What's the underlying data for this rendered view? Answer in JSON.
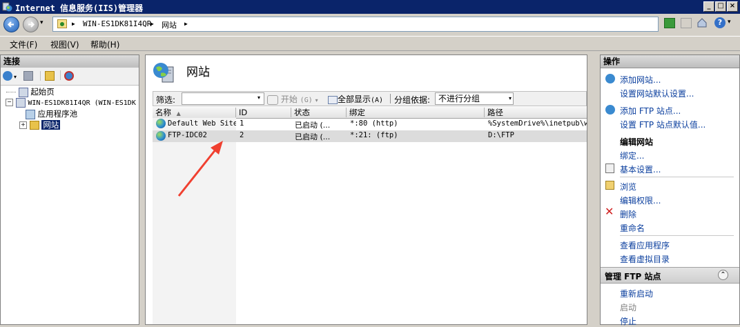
{
  "window": {
    "title": "Internet 信息服务(IIS)管理器",
    "controls": {
      "minimize": "_",
      "maximize": "□",
      "close": "×"
    }
  },
  "address": {
    "arrow": "▶",
    "segments": [
      "WIN-ES1DK81I4QR",
      "网站"
    ]
  },
  "menu": {
    "items": [
      "文件(F)",
      "视图(V)",
      "帮助(H)"
    ]
  },
  "connections": {
    "header": "连接",
    "tree": [
      {
        "label": "起始页"
      },
      {
        "label": "WIN-ES1DK81I4QR (WIN-ES1DK"
      },
      {
        "label": "应用程序池"
      },
      {
        "label": "网站"
      }
    ]
  },
  "center": {
    "title": "网站",
    "filter": {
      "label": "筛选:",
      "start_label": "开始",
      "start_shortcut": "(G)",
      "show_all": "全部显示",
      "show_all_shortcut": "(A)",
      "group_by_label": "分组依据:",
      "group_by_value": "不进行分组"
    },
    "columns": [
      "名称",
      "ID",
      "状态",
      "绑定",
      "路径"
    ],
    "rows": [
      {
        "name": "Default Web Site",
        "id": "1",
        "status": "已启动 (...",
        "binding": "*:80 (http)",
        "path": "%SystemDrive%\\inetpub\\ww"
      },
      {
        "name": "FTP-IDC02",
        "id": "2",
        "status": "已启动 (...",
        "binding": "*:21: (ftp)",
        "path": "D:\\FTP"
      }
    ]
  },
  "actions": {
    "header": "操作",
    "group1": [
      "添加网站...",
      "设置网站默认设置..."
    ],
    "group2": [
      "添加 FTP 站点...",
      "设置 FTP 站点默认值..."
    ],
    "edit_header": "编辑网站",
    "edit_items": [
      "绑定...",
      "基本设置..."
    ],
    "browse_items": [
      "浏览",
      "编辑权限...",
      "删除",
      "重命名"
    ],
    "view_items": [
      "查看应用程序",
      "查看虚拟目录"
    ],
    "ftp_section": "管理 FTP 站点",
    "ftp_items": [
      "重新启动",
      "启动",
      "停止"
    ],
    "collapse_icon": "⌃"
  },
  "colors": {
    "titlebar": "#0a246a",
    "selection": "#0a246a",
    "annotation_arrow": "#f04030",
    "action_link": "#0b3f9e"
  }
}
